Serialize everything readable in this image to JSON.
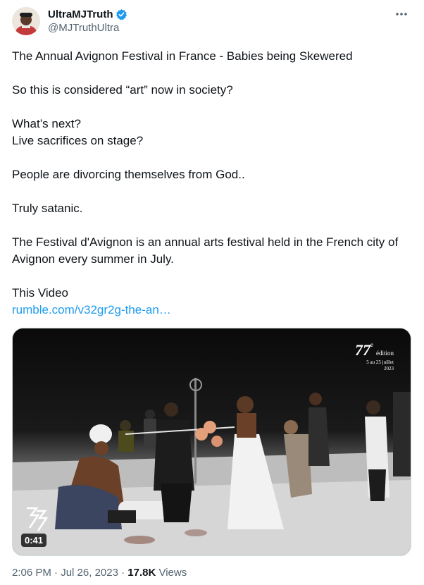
{
  "author": {
    "display_name": "UltraMJTruth",
    "handle": "@MJTruthUltra",
    "verified": true
  },
  "tweet": {
    "lines": [
      "The Annual Avignon Festival in France - Babies being Skewered",
      "So this is considered “art” now in society?",
      "What’s next?",
      "Live sacrifices on stage?",
      "People are divorcing themselves from God..",
      "Truly satanic.",
      "The Festival d'Avignon is an annual arts festival held in the French city of Avignon every summer in July.",
      "This Video"
    ],
    "link_text": "rumble.com/v32gr2g-the-an…"
  },
  "media": {
    "duration": "0:41",
    "overlay": {
      "number": "77",
      "sup": "e",
      "label": "édition",
      "dates_line1": "5 au 25 juillet",
      "dates_line2": "2023"
    }
  },
  "footer": {
    "time": "2:06 PM",
    "sep1": " · ",
    "date": "Jul 26, 2023",
    "sep2": " · ",
    "views_count": "17.8K",
    "views_label": " Views"
  },
  "colors": {
    "link": "#1d9bf0",
    "verified": "#1d9bf0",
    "secondary_text": "#536471"
  },
  "icons": [
    "verified-badge-icon",
    "more-options-icon",
    "festival-logo-icon"
  ]
}
